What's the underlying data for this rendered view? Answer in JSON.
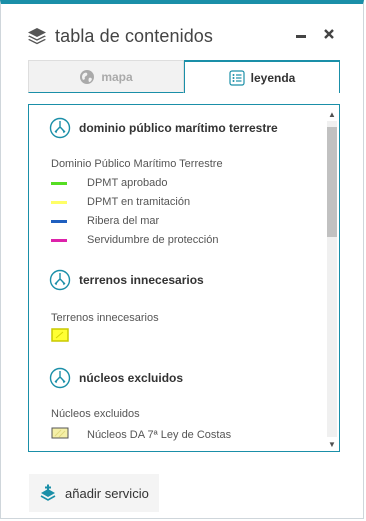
{
  "panel": {
    "title": "tabla de contenidos",
    "icons": {
      "header": "layers-icon",
      "minimize": "minimize-icon",
      "close": "close-icon"
    },
    "accent_color": "#1a8fa8"
  },
  "tabs": [
    {
      "label": "mapa",
      "icon": "globe-icon",
      "active": false
    },
    {
      "label": "leyenda",
      "icon": "legend-icon",
      "active": true
    }
  ],
  "legend": {
    "groups": [
      {
        "title": "dominio público marítimo terrestre",
        "icon": "service-icon",
        "layer": "Dominio Público Marítimo Terrestre",
        "items": [
          {
            "label": "DPMT aprobado",
            "color": "#55dd22"
          },
          {
            "label": "DPMT en tramitación",
            "color": "#ffff66"
          },
          {
            "label": "Ribera del mar",
            "color": "#1f5fbf"
          },
          {
            "label": "Servidumbre de protección",
            "color": "#dd22aa"
          }
        ]
      },
      {
        "title": "terrenos innecesarios",
        "icon": "service-icon",
        "layer": "Terrenos innecesarios",
        "items": [
          {
            "label": "",
            "color": "#ffff33"
          }
        ]
      },
      {
        "title": "núcleos excluidos",
        "icon": "service-icon",
        "layer": "Núcleos excluidos",
        "items": [
          {
            "label": "Núcleos DA 7ª Ley de Costas",
            "color": "#f5f0a8"
          }
        ]
      }
    ]
  },
  "footer": {
    "add_service_label": "añadir servicio",
    "icon": "add-service-icon"
  }
}
